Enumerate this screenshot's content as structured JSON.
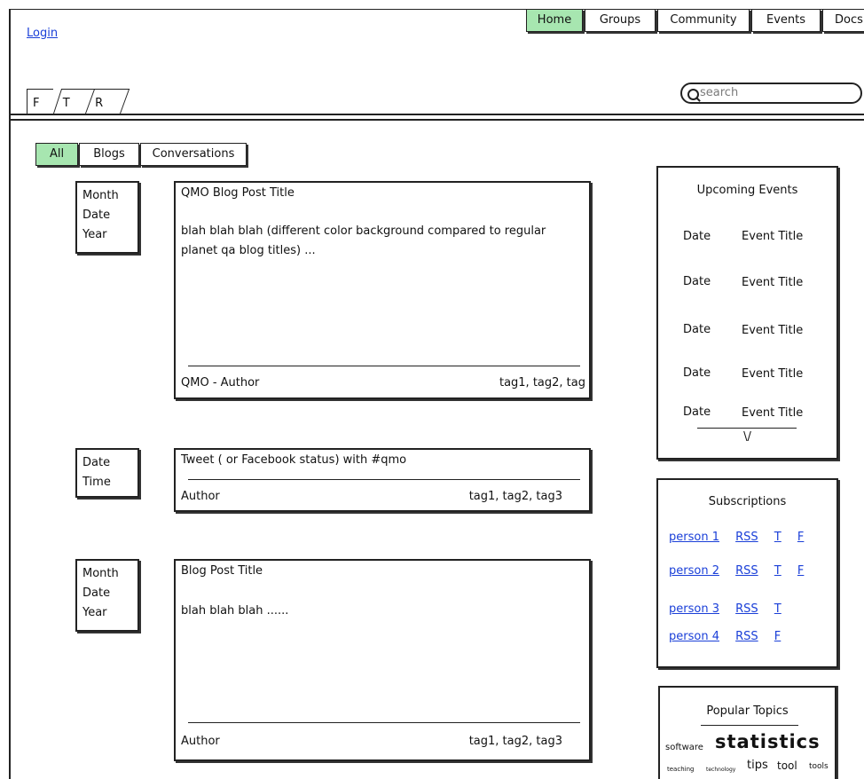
{
  "header": {
    "login": "Login",
    "nav": [
      "Home",
      "Groups",
      "Community",
      "Events",
      "Docs"
    ],
    "ftr_tabs": [
      "F",
      "T",
      "R"
    ],
    "search_placeholder": "search"
  },
  "filters": [
    "All",
    "Blogs",
    "Conversations"
  ],
  "posts": [
    {
      "date_lines": [
        "Month",
        "Date",
        "Year"
      ],
      "title": "QMO Blog Post Title",
      "body": "blah blah blah (different color background compared to regular planet qa blog titles) ...",
      "author": "QMO - Author",
      "tags": "tag1, tag2, tag"
    },
    {
      "date_lines": [
        "Date",
        "Time"
      ],
      "title": "Tweet ( or Facebook status) with #qmo",
      "body": "",
      "author": "Author",
      "tags": "tag1, tag2, tag3"
    },
    {
      "date_lines": [
        "Month",
        "Date",
        "Year"
      ],
      "title": "Blog Post Title",
      "body": "blah blah blah ......",
      "author": "Author",
      "tags": "tag1, tag2, tag3"
    }
  ],
  "upcoming_events": {
    "title": "Upcoming Events",
    "items": [
      {
        "date": "Date",
        "title": "Event Title"
      },
      {
        "date": "Date",
        "title": "Event Title"
      },
      {
        "date": "Date",
        "title": "Event Title"
      },
      {
        "date": "Date",
        "title": "Event Title"
      },
      {
        "date": "Date",
        "title": "Event Title"
      }
    ],
    "more": "\\/"
  },
  "subscriptions": {
    "title": "Subscriptions",
    "rows": [
      {
        "person": "person 1",
        "links": [
          "RSS",
          "T",
          "F"
        ]
      },
      {
        "person": "person 2",
        "links": [
          "RSS",
          "T",
          "F"
        ]
      },
      {
        "person": "person 3",
        "links": [
          "RSS",
          "T"
        ]
      },
      {
        "person": "person 4",
        "links": [
          "RSS",
          "F"
        ]
      }
    ]
  },
  "popular_topics": {
    "title": "Popular Topics",
    "tags": [
      "software",
      "statistics",
      "teaching",
      "technology",
      "tips",
      "tool",
      "tools"
    ]
  }
}
